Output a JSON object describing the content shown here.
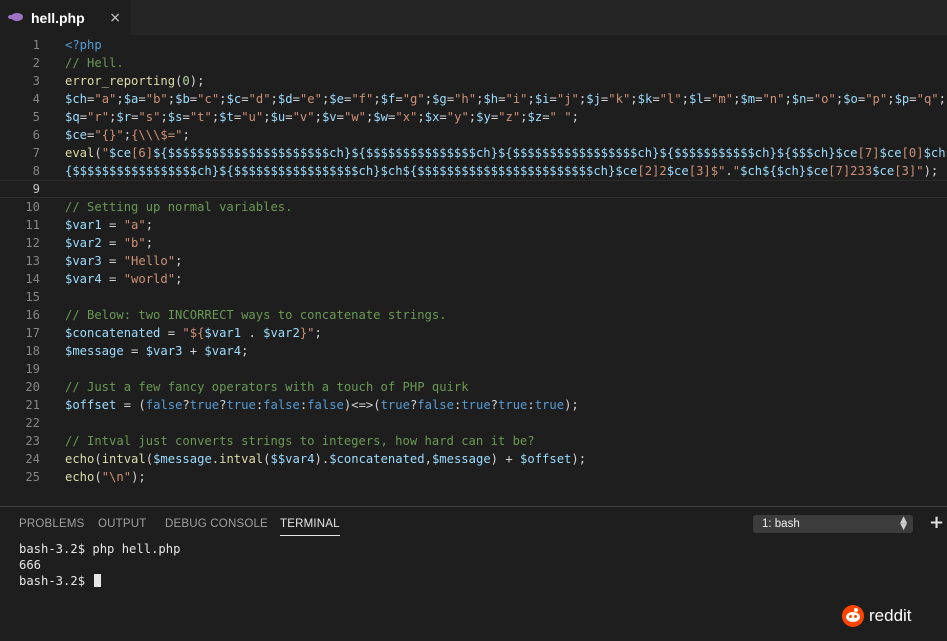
{
  "tab": {
    "icon": "php-elephant-icon",
    "title": "hell.php",
    "close": "×"
  },
  "editor": {
    "active_line": 9,
    "lines": [
      [
        {
          "t": "<?php",
          "c": "#569cd6"
        }
      ],
      [
        {
          "t": "// Hell.",
          "c": "#6a9955"
        }
      ],
      [
        {
          "t": "error_reporting",
          "c": "#dcdcaa"
        },
        {
          "t": "(",
          "c": "#d4d4d4"
        },
        {
          "t": "0",
          "c": "#b5cea8"
        },
        {
          "t": ");",
          "c": "#d4d4d4"
        }
      ],
      [
        {
          "t": "$ch",
          "c": "#9cdcfe"
        },
        {
          "t": "=",
          "c": "#d4d4d4"
        },
        {
          "t": "\"a\"",
          "c": "#ce9178"
        },
        {
          "t": ";",
          "c": "#d4d4d4"
        },
        {
          "t": "$a",
          "c": "#9cdcfe"
        },
        {
          "t": "=",
          "c": "#d4d4d4"
        },
        {
          "t": "\"b\"",
          "c": "#ce9178"
        },
        {
          "t": ";",
          "c": "#d4d4d4"
        },
        {
          "t": "$b",
          "c": "#9cdcfe"
        },
        {
          "t": "=",
          "c": "#d4d4d4"
        },
        {
          "t": "\"c\"",
          "c": "#ce9178"
        },
        {
          "t": ";",
          "c": "#d4d4d4"
        },
        {
          "t": "$c",
          "c": "#9cdcfe"
        },
        {
          "t": "=",
          "c": "#d4d4d4"
        },
        {
          "t": "\"d\"",
          "c": "#ce9178"
        },
        {
          "t": ";",
          "c": "#d4d4d4"
        },
        {
          "t": "$d",
          "c": "#9cdcfe"
        },
        {
          "t": "=",
          "c": "#d4d4d4"
        },
        {
          "t": "\"e\"",
          "c": "#ce9178"
        },
        {
          "t": ";",
          "c": "#d4d4d4"
        },
        {
          "t": "$e",
          "c": "#9cdcfe"
        },
        {
          "t": "=",
          "c": "#d4d4d4"
        },
        {
          "t": "\"f\"",
          "c": "#ce9178"
        },
        {
          "t": ";",
          "c": "#d4d4d4"
        },
        {
          "t": "$f",
          "c": "#9cdcfe"
        },
        {
          "t": "=",
          "c": "#d4d4d4"
        },
        {
          "t": "\"g\"",
          "c": "#ce9178"
        },
        {
          "t": ";",
          "c": "#d4d4d4"
        },
        {
          "t": "$g",
          "c": "#9cdcfe"
        },
        {
          "t": "=",
          "c": "#d4d4d4"
        },
        {
          "t": "\"h\"",
          "c": "#ce9178"
        },
        {
          "t": ";",
          "c": "#d4d4d4"
        },
        {
          "t": "$h",
          "c": "#9cdcfe"
        },
        {
          "t": "=",
          "c": "#d4d4d4"
        },
        {
          "t": "\"i\"",
          "c": "#ce9178"
        },
        {
          "t": ";",
          "c": "#d4d4d4"
        },
        {
          "t": "$i",
          "c": "#9cdcfe"
        },
        {
          "t": "=",
          "c": "#d4d4d4"
        },
        {
          "t": "\"j\"",
          "c": "#ce9178"
        },
        {
          "t": ";",
          "c": "#d4d4d4"
        },
        {
          "t": "$j",
          "c": "#9cdcfe"
        },
        {
          "t": "=",
          "c": "#d4d4d4"
        },
        {
          "t": "\"k\"",
          "c": "#ce9178"
        },
        {
          "t": ";",
          "c": "#d4d4d4"
        },
        {
          "t": "$k",
          "c": "#9cdcfe"
        },
        {
          "t": "=",
          "c": "#d4d4d4"
        },
        {
          "t": "\"l\"",
          "c": "#ce9178"
        },
        {
          "t": ";",
          "c": "#d4d4d4"
        },
        {
          "t": "$l",
          "c": "#9cdcfe"
        },
        {
          "t": "=",
          "c": "#d4d4d4"
        },
        {
          "t": "\"m\"",
          "c": "#ce9178"
        },
        {
          "t": ";",
          "c": "#d4d4d4"
        },
        {
          "t": "$m",
          "c": "#9cdcfe"
        },
        {
          "t": "=",
          "c": "#d4d4d4"
        },
        {
          "t": "\"n\"",
          "c": "#ce9178"
        },
        {
          "t": ";",
          "c": "#d4d4d4"
        },
        {
          "t": "$n",
          "c": "#9cdcfe"
        },
        {
          "t": "=",
          "c": "#d4d4d4"
        },
        {
          "t": "\"o\"",
          "c": "#ce9178"
        },
        {
          "t": ";",
          "c": "#d4d4d4"
        },
        {
          "t": "$o",
          "c": "#9cdcfe"
        },
        {
          "t": "=",
          "c": "#d4d4d4"
        },
        {
          "t": "\"p\"",
          "c": "#ce9178"
        },
        {
          "t": ";",
          "c": "#d4d4d4"
        },
        {
          "t": "$p",
          "c": "#9cdcfe"
        },
        {
          "t": "=",
          "c": "#d4d4d4"
        },
        {
          "t": "\"q\"",
          "c": "#ce9178"
        },
        {
          "t": ";",
          "c": "#d4d4d4"
        }
      ],
      [
        {
          "t": "$q",
          "c": "#9cdcfe"
        },
        {
          "t": "=",
          "c": "#d4d4d4"
        },
        {
          "t": "\"r\"",
          "c": "#ce9178"
        },
        {
          "t": ";",
          "c": "#d4d4d4"
        },
        {
          "t": "$r",
          "c": "#9cdcfe"
        },
        {
          "t": "=",
          "c": "#d4d4d4"
        },
        {
          "t": "\"s\"",
          "c": "#ce9178"
        },
        {
          "t": ";",
          "c": "#d4d4d4"
        },
        {
          "t": "$s",
          "c": "#9cdcfe"
        },
        {
          "t": "=",
          "c": "#d4d4d4"
        },
        {
          "t": "\"t\"",
          "c": "#ce9178"
        },
        {
          "t": ";",
          "c": "#d4d4d4"
        },
        {
          "t": "$t",
          "c": "#9cdcfe"
        },
        {
          "t": "=",
          "c": "#d4d4d4"
        },
        {
          "t": "\"u\"",
          "c": "#ce9178"
        },
        {
          "t": ";",
          "c": "#d4d4d4"
        },
        {
          "t": "$u",
          "c": "#9cdcfe"
        },
        {
          "t": "=",
          "c": "#d4d4d4"
        },
        {
          "t": "\"v\"",
          "c": "#ce9178"
        },
        {
          "t": ";",
          "c": "#d4d4d4"
        },
        {
          "t": "$v",
          "c": "#9cdcfe"
        },
        {
          "t": "=",
          "c": "#d4d4d4"
        },
        {
          "t": "\"w\"",
          "c": "#ce9178"
        },
        {
          "t": ";",
          "c": "#d4d4d4"
        },
        {
          "t": "$w",
          "c": "#9cdcfe"
        },
        {
          "t": "=",
          "c": "#d4d4d4"
        },
        {
          "t": "\"x\"",
          "c": "#ce9178"
        },
        {
          "t": ";",
          "c": "#d4d4d4"
        },
        {
          "t": "$x",
          "c": "#9cdcfe"
        },
        {
          "t": "=",
          "c": "#d4d4d4"
        },
        {
          "t": "\"y\"",
          "c": "#ce9178"
        },
        {
          "t": ";",
          "c": "#d4d4d4"
        },
        {
          "t": "$y",
          "c": "#9cdcfe"
        },
        {
          "t": "=",
          "c": "#d4d4d4"
        },
        {
          "t": "\"z\"",
          "c": "#ce9178"
        },
        {
          "t": ";",
          "c": "#d4d4d4"
        },
        {
          "t": "$z",
          "c": "#9cdcfe"
        },
        {
          "t": "=",
          "c": "#d4d4d4"
        },
        {
          "t": "\" \"",
          "c": "#ce9178"
        },
        {
          "t": ";",
          "c": "#d4d4d4"
        }
      ],
      [
        {
          "t": "$ce",
          "c": "#9cdcfe"
        },
        {
          "t": "=",
          "c": "#d4d4d4"
        },
        {
          "t": "\"{}\"",
          "c": "#ce9178"
        },
        {
          "t": ";",
          "c": "#d4d4d4"
        },
        {
          "t": "{\\\\\\$=\"",
          "c": "#ce9178"
        },
        {
          "t": ";",
          "c": "#d4d4d4"
        }
      ],
      [
        {
          "t": "eval",
          "c": "#dcdcaa"
        },
        {
          "t": "(",
          "c": "#d4d4d4"
        },
        {
          "t": "\"",
          "c": "#ce9178"
        },
        {
          "t": "$ce",
          "c": "#9cdcfe"
        },
        {
          "t": "[6]",
          "c": "#ce9178"
        },
        {
          "t": "${$$$$$$$$$$$$$$$$$$$$$$ch}",
          "c": "#9cdcfe"
        },
        {
          "t": "${$$$$$$$$$$$$$$$ch}",
          "c": "#9cdcfe"
        },
        {
          "t": "${$$$$$$$$$$$$$$$$$ch}",
          "c": "#9cdcfe"
        },
        {
          "t": "${$$$$$$$$$$$ch}",
          "c": "#9cdcfe"
        },
        {
          "t": "${$$$ch}",
          "c": "#9cdcfe"
        },
        {
          "t": "$ce",
          "c": "#9cdcfe"
        },
        {
          "t": "[7]",
          "c": "#ce9178"
        },
        {
          "t": "$ce",
          "c": "#9cdcfe"
        },
        {
          "t": "[0]",
          "c": "#ce9178"
        },
        {
          "t": "$ch",
          "c": "#9cdcfe"
        },
        {
          "t": "$",
          "c": "#ce9178"
        }
      ],
      [
        {
          "t": "{$$$$$$$$$$$$$$$$$ch}",
          "c": "#9cdcfe"
        },
        {
          "t": "${$$$$$$$$$$$$$$$$$ch}",
          "c": "#9cdcfe"
        },
        {
          "t": "$ch",
          "c": "#9cdcfe"
        },
        {
          "t": "${$$$$$$$$$$$$$$$$$$$$$$$$ch}",
          "c": "#9cdcfe"
        },
        {
          "t": "$ce",
          "c": "#9cdcfe"
        },
        {
          "t": "[2]2",
          "c": "#ce9178"
        },
        {
          "t": "$ce",
          "c": "#9cdcfe"
        },
        {
          "t": "[3]$\"",
          "c": "#ce9178"
        },
        {
          "t": ".",
          "c": "#d4d4d4"
        },
        {
          "t": "\"",
          "c": "#ce9178"
        },
        {
          "t": "$ch",
          "c": "#9cdcfe"
        },
        {
          "t": "${$ch}",
          "c": "#9cdcfe"
        },
        {
          "t": "$ce",
          "c": "#9cdcfe"
        },
        {
          "t": "[7]233",
          "c": "#ce9178"
        },
        {
          "t": "$ce",
          "c": "#9cdcfe"
        },
        {
          "t": "[3]\"",
          "c": "#ce9178"
        },
        {
          "t": ");",
          "c": "#d4d4d4"
        }
      ],
      [],
      [
        {
          "t": "// Setting up normal variables.",
          "c": "#6a9955"
        }
      ],
      [
        {
          "t": "$var1",
          "c": "#9cdcfe"
        },
        {
          "t": " = ",
          "c": "#d4d4d4"
        },
        {
          "t": "\"a\"",
          "c": "#ce9178"
        },
        {
          "t": ";",
          "c": "#d4d4d4"
        }
      ],
      [
        {
          "t": "$var2",
          "c": "#9cdcfe"
        },
        {
          "t": " = ",
          "c": "#d4d4d4"
        },
        {
          "t": "\"b\"",
          "c": "#ce9178"
        },
        {
          "t": ";",
          "c": "#d4d4d4"
        }
      ],
      [
        {
          "t": "$var3",
          "c": "#9cdcfe"
        },
        {
          "t": " = ",
          "c": "#d4d4d4"
        },
        {
          "t": "\"Hello\"",
          "c": "#ce9178"
        },
        {
          "t": ";",
          "c": "#d4d4d4"
        }
      ],
      [
        {
          "t": "$var4",
          "c": "#9cdcfe"
        },
        {
          "t": " = ",
          "c": "#d4d4d4"
        },
        {
          "t": "\"world\"",
          "c": "#ce9178"
        },
        {
          "t": ";",
          "c": "#d4d4d4"
        }
      ],
      [],
      [
        {
          "t": "// Below: two INCORRECT ways to concatenate strings.",
          "c": "#6a9955"
        }
      ],
      [
        {
          "t": "$concatenated",
          "c": "#9cdcfe"
        },
        {
          "t": " = ",
          "c": "#d4d4d4"
        },
        {
          "t": "\"${",
          "c": "#ce9178"
        },
        {
          "t": "$var1",
          "c": "#9cdcfe"
        },
        {
          "t": " . ",
          "c": "#d4d4d4"
        },
        {
          "t": "$var2",
          "c": "#9cdcfe"
        },
        {
          "t": "}\"",
          "c": "#ce9178"
        },
        {
          "t": ";",
          "c": "#d4d4d4"
        }
      ],
      [
        {
          "t": "$message",
          "c": "#9cdcfe"
        },
        {
          "t": " = ",
          "c": "#d4d4d4"
        },
        {
          "t": "$var3",
          "c": "#9cdcfe"
        },
        {
          "t": " + ",
          "c": "#d4d4d4"
        },
        {
          "t": "$var4",
          "c": "#9cdcfe"
        },
        {
          "t": ";",
          "c": "#d4d4d4"
        }
      ],
      [],
      [
        {
          "t": "// Just a few fancy operators with a touch of PHP quirk",
          "c": "#6a9955"
        }
      ],
      [
        {
          "t": "$offset",
          "c": "#9cdcfe"
        },
        {
          "t": " = (",
          "c": "#d4d4d4"
        },
        {
          "t": "false",
          "c": "#569cd6"
        },
        {
          "t": "?",
          "c": "#d4d4d4"
        },
        {
          "t": "true",
          "c": "#569cd6"
        },
        {
          "t": "?",
          "c": "#d4d4d4"
        },
        {
          "t": "true",
          "c": "#569cd6"
        },
        {
          "t": ":",
          "c": "#d4d4d4"
        },
        {
          "t": "false",
          "c": "#569cd6"
        },
        {
          "t": ":",
          "c": "#d4d4d4"
        },
        {
          "t": "false",
          "c": "#569cd6"
        },
        {
          "t": ")<=>(",
          "c": "#d4d4d4"
        },
        {
          "t": "true",
          "c": "#569cd6"
        },
        {
          "t": "?",
          "c": "#d4d4d4"
        },
        {
          "t": "false",
          "c": "#569cd6"
        },
        {
          "t": ":",
          "c": "#d4d4d4"
        },
        {
          "t": "true",
          "c": "#569cd6"
        },
        {
          "t": "?",
          "c": "#d4d4d4"
        },
        {
          "t": "true",
          "c": "#569cd6"
        },
        {
          "t": ":",
          "c": "#d4d4d4"
        },
        {
          "t": "true",
          "c": "#569cd6"
        },
        {
          "t": ");",
          "c": "#d4d4d4"
        }
      ],
      [],
      [
        {
          "t": "// Intval just converts strings to integers, how hard can it be?",
          "c": "#6a9955"
        }
      ],
      [
        {
          "t": "echo",
          "c": "#dcdcaa"
        },
        {
          "t": "(",
          "c": "#d4d4d4"
        },
        {
          "t": "intval",
          "c": "#dcdcaa"
        },
        {
          "t": "(",
          "c": "#d4d4d4"
        },
        {
          "t": "$message",
          "c": "#9cdcfe"
        },
        {
          "t": ".",
          "c": "#d4d4d4"
        },
        {
          "t": "intval",
          "c": "#dcdcaa"
        },
        {
          "t": "(",
          "c": "#d4d4d4"
        },
        {
          "t": "$$var4",
          "c": "#9cdcfe"
        },
        {
          "t": ").",
          "c": "#d4d4d4"
        },
        {
          "t": "$concatenated",
          "c": "#9cdcfe"
        },
        {
          "t": ",",
          "c": "#d4d4d4"
        },
        {
          "t": "$message",
          "c": "#9cdcfe"
        },
        {
          "t": ") + ",
          "c": "#d4d4d4"
        },
        {
          "t": "$offset",
          "c": "#9cdcfe"
        },
        {
          "t": ");",
          "c": "#d4d4d4"
        }
      ],
      [
        {
          "t": "echo",
          "c": "#dcdcaa"
        },
        {
          "t": "(",
          "c": "#d4d4d4"
        },
        {
          "t": "\"\\n\"",
          "c": "#ce9178"
        },
        {
          "t": ");",
          "c": "#d4d4d4"
        }
      ]
    ]
  },
  "panel": {
    "tabs": [
      "PROBLEMS",
      "OUTPUT",
      "DEBUG CONSOLE",
      "TERMINAL"
    ],
    "active_tab": "TERMINAL",
    "terminal_select": "1: bash",
    "add_icon": "plus-icon",
    "terminal_lines": [
      "bash-3.2$ php hell.php",
      "666",
      "bash-3.2$ "
    ]
  },
  "watermark": {
    "logo": "reddit-alien-icon",
    "text": "reddit"
  }
}
